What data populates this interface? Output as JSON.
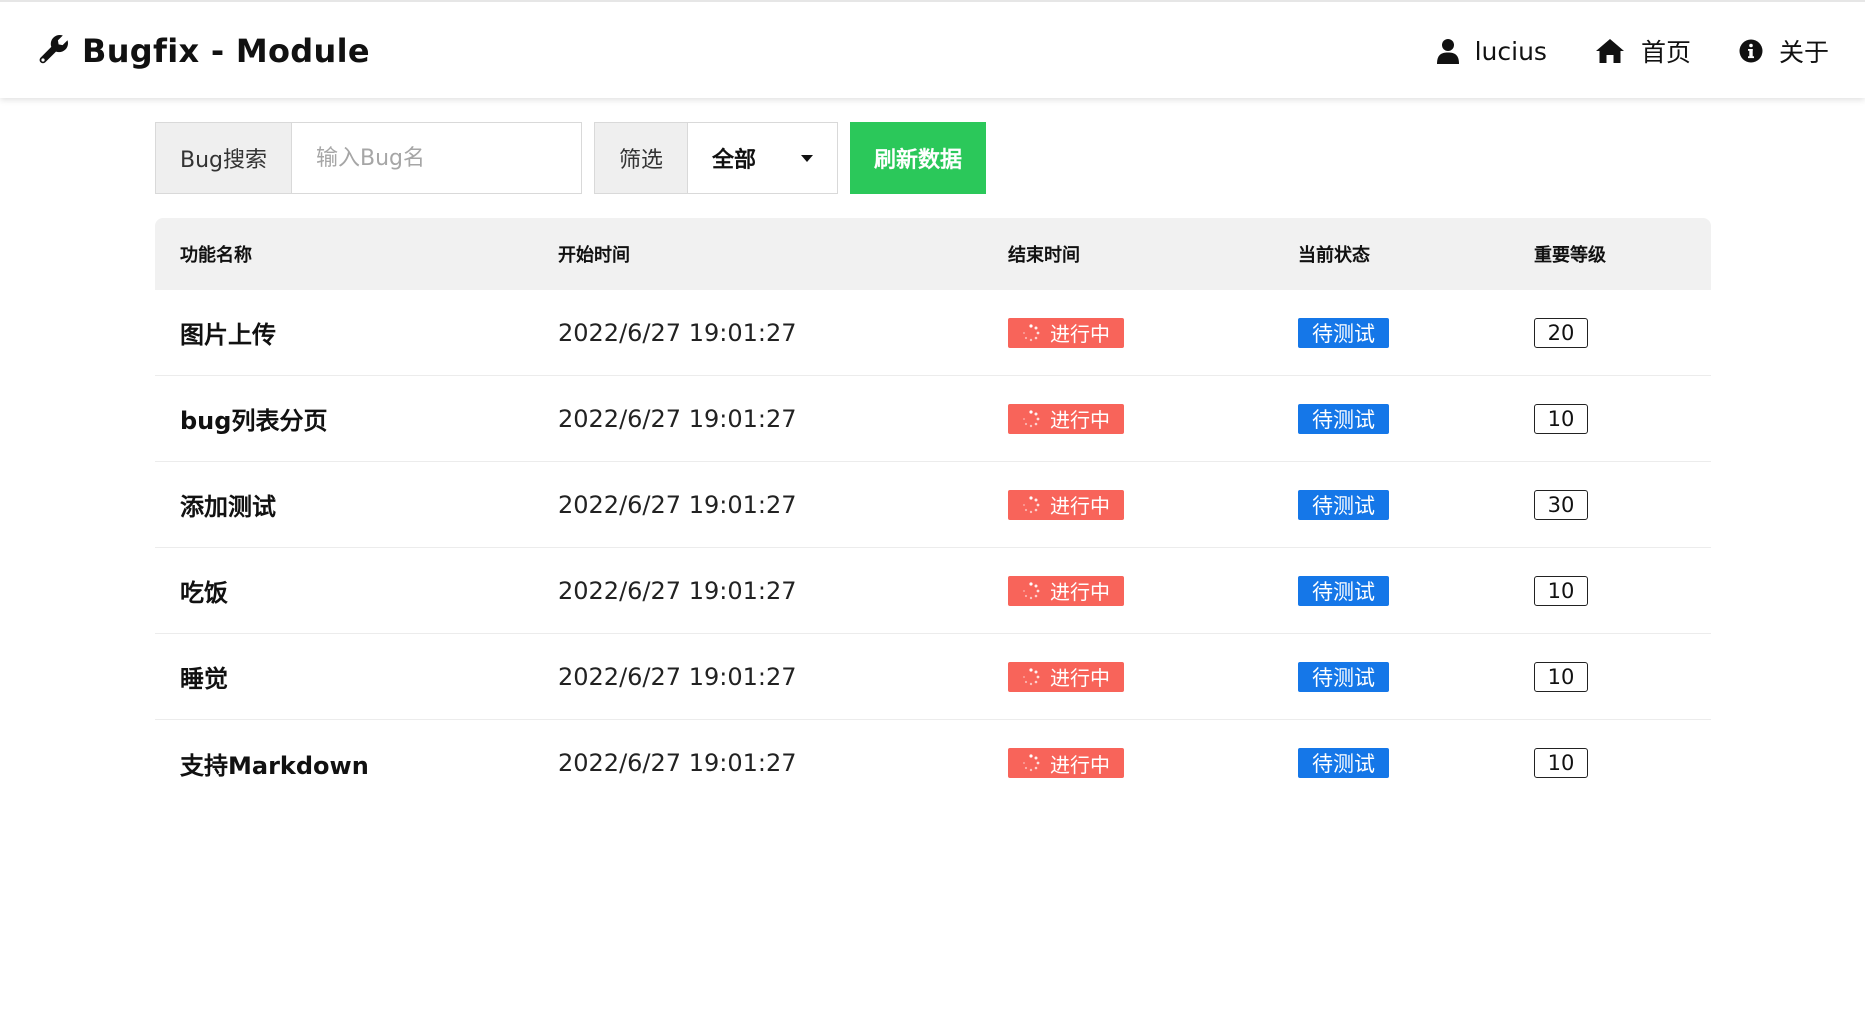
{
  "header": {
    "title": "Bugfix - Module",
    "nav": [
      {
        "icon": "user-icon",
        "label": "lucius"
      },
      {
        "icon": "home-icon",
        "label": "首页"
      },
      {
        "icon": "info-icon",
        "label": "关于"
      }
    ]
  },
  "toolbar": {
    "search_label": "Bug搜索",
    "search_placeholder": "输入Bug名",
    "search_value": "",
    "filter_label": "筛选",
    "filter_value": "全部",
    "refresh_label": "刷新数据"
  },
  "table": {
    "columns": [
      "功能名称",
      "开始时间",
      "结束时间",
      "当前状态",
      "重要等级"
    ],
    "rows": [
      {
        "name": "图片上传",
        "start": "2022/6/27 19:01:27",
        "end_status": "进行中",
        "status": "待测试",
        "level": "20"
      },
      {
        "name": "bug列表分页",
        "start": "2022/6/27 19:01:27",
        "end_status": "进行中",
        "status": "待测试",
        "level": "10"
      },
      {
        "name": "添加测试",
        "start": "2022/6/27 19:01:27",
        "end_status": "进行中",
        "status": "待测试",
        "level": "30"
      },
      {
        "name": "吃饭",
        "start": "2022/6/27 19:01:27",
        "end_status": "进行中",
        "status": "待测试",
        "level": "10"
      },
      {
        "name": "睡觉",
        "start": "2022/6/27 19:01:27",
        "end_status": "进行中",
        "status": "待测试",
        "level": "10"
      },
      {
        "name": "支持Markdown",
        "start": "2022/6/27 19:01:27",
        "end_status": "进行中",
        "status": "待测试",
        "level": "10"
      }
    ]
  },
  "colors": {
    "refresh_button": "#2bc85a",
    "in_progress_tag": "#f8645a",
    "pending_test_tag": "#1577e8",
    "table_header_bg": "#f1f1f1"
  }
}
